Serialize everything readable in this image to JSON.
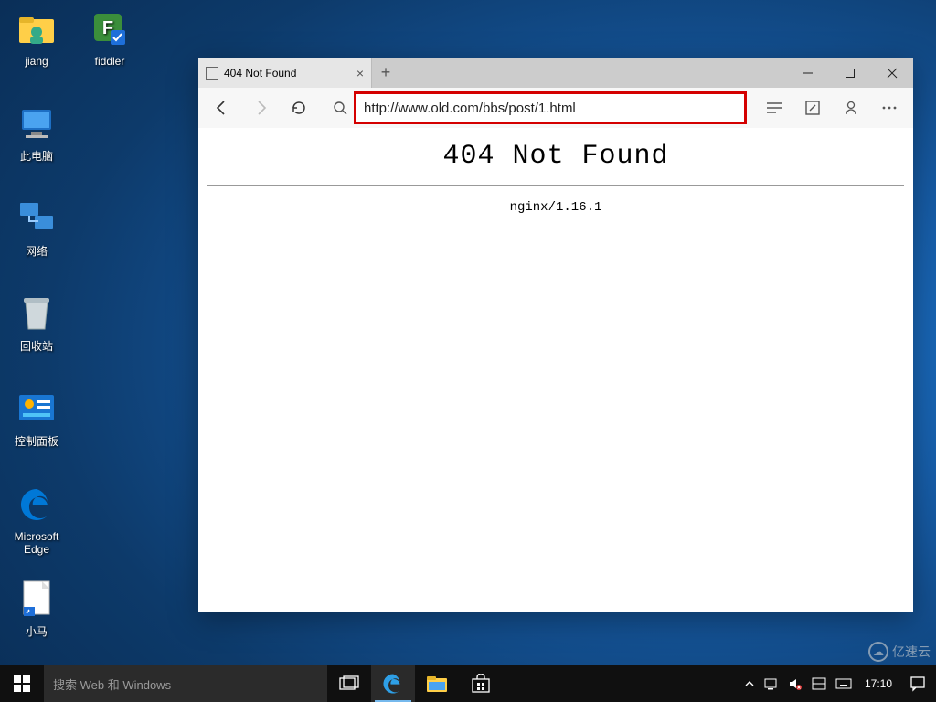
{
  "desktop": {
    "icons": [
      {
        "name": "jiang",
        "kind": "user-folder"
      },
      {
        "name": "fiddler",
        "kind": "fiddler"
      },
      {
        "name": "此电脑",
        "kind": "this-pc"
      },
      {
        "name": "网络",
        "kind": "network"
      },
      {
        "name": "回收站",
        "kind": "recycle-bin"
      },
      {
        "name": "控制面板",
        "kind": "control-panel"
      },
      {
        "name": "Microsoft Edge",
        "kind": "edge"
      },
      {
        "name": "小马",
        "kind": "shortcut-file"
      }
    ]
  },
  "browser": {
    "tab_title": "404 Not Found",
    "url": "http://www.old.com/bbs/post/1.html",
    "url_highlighted": true,
    "page": {
      "heading": "404 Not Found",
      "server": "nginx/1.16.1"
    }
  },
  "taskbar": {
    "search_placeholder": "搜索 Web 和 Windows",
    "time": "17:10",
    "date_hint": ""
  },
  "watermark": "亿速云"
}
